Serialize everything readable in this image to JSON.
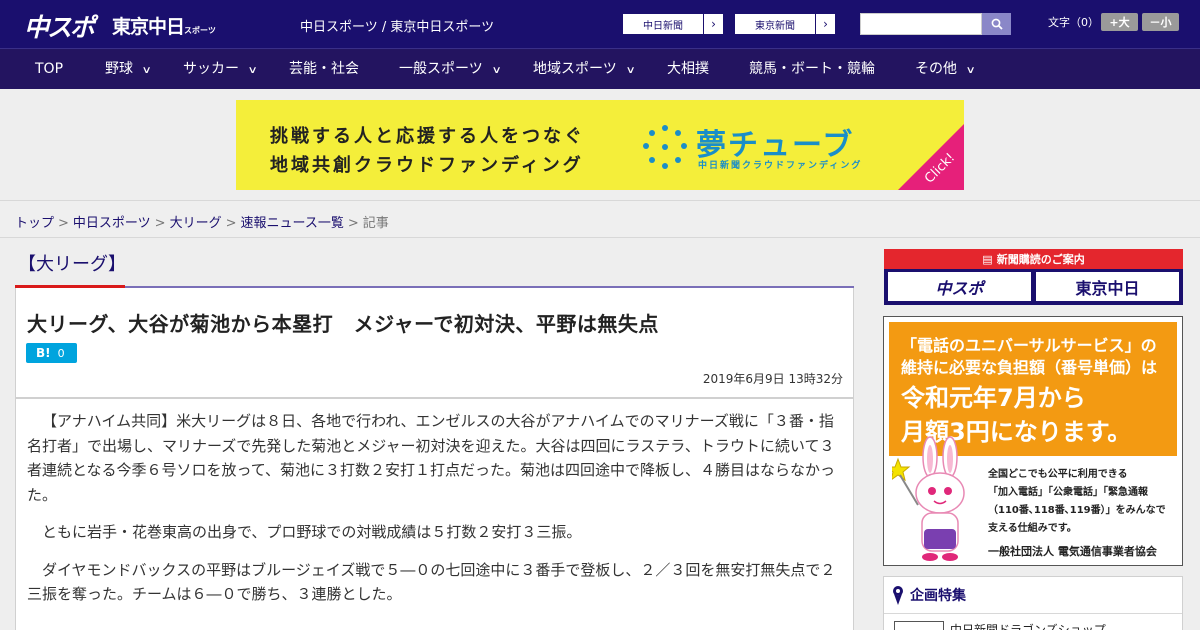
{
  "header": {
    "logo_chunichi": "中スポ",
    "logo_tokyo": "東京中日",
    "logo_tokyo_suffix": "スポーツ",
    "site_links": "中日スポーツ / 東京中日スポーツ",
    "external_links": [
      {
        "label": "中日新聞"
      },
      {
        "label": "東京新聞"
      }
    ],
    "search": {
      "value": "",
      "placeholder": ""
    },
    "font_size_label": "文字（0）",
    "font_larger": "+大",
    "font_smaller": "－小"
  },
  "nav": {
    "items": [
      {
        "label": "TOP",
        "has_dropdown": false
      },
      {
        "label": "野球",
        "has_dropdown": true
      },
      {
        "label": "サッカー",
        "has_dropdown": true
      },
      {
        "label": "芸能・社会",
        "has_dropdown": false
      },
      {
        "label": "一般スポーツ",
        "has_dropdown": true
      },
      {
        "label": "地域スポーツ",
        "has_dropdown": true
      },
      {
        "label": "大相撲",
        "has_dropdown": false
      },
      {
        "label": "競馬・ボート・競輪",
        "has_dropdown": false
      },
      {
        "label": "その他",
        "has_dropdown": true
      }
    ]
  },
  "banner": {
    "line1": "挑戦する人と応援する人をつなぐ",
    "line2": "地域共創クラウドファンディング",
    "brand": "夢チューブ",
    "brand_sub": "中日新聞クラウドファンディング",
    "click_label": "Click!",
    "colors": {
      "background": "#f4ee3a",
      "brand": "#1a8ec8",
      "click": "#e6207a"
    }
  },
  "breadcrumb": {
    "items": [
      "トップ",
      "中日スポーツ",
      "大リーグ",
      "速報ニュース一覧"
    ],
    "current": "記事"
  },
  "article": {
    "category": "【大リーグ】",
    "title": "大リーグ、大谷が菊池から本塁打　メジャーで初対決、平野は無失点",
    "hatena_label": "B!",
    "hatena_count": "0",
    "date": "2019年6月9日 13時32分",
    "paragraphs": [
      "【アナハイム共同】米大リーグは８日、各地で行われ、エンゼルスの大谷がアナハイムでのマリナーズ戦に「３番・指名打者」で出場し、マリナーズで先発した菊池とメジャー初対決を迎えた。大谷は四回にラステラ、トラウトに続いて３者連続となる今季６号ソロを放って、菊池に３打数２安打１打点だった。菊池は四回途中で降板し、４勝目はならなかった。",
      "ともに岩手・花巻東高の出身で、プロ野球での対戦成績は５打数２安打３三振。",
      "ダイヤモンドバックスの平野はブルージェイズ戦で５―０の七回途中に３番手で登板し、２／３回を無安打無失点で２三振を奪った。チームは６―０で勝ち、３連勝とした。"
    ]
  },
  "sidebar": {
    "subscription_heading": "新聞購読のご案内",
    "subscription_logos": [
      "中スポ",
      "東京中日"
    ],
    "ad": {
      "line1": "「電話のユニバーサルサービス」の",
      "line2": "維持に必要な負担額（番号単価）は",
      "line3": "令和元年7月から",
      "line4": "月額3円になります。",
      "body": [
        "全国どこでも公平に利用できる",
        "「加入電話」「公衆電話」「緊急通報",
        "（110番､118番､119番）」をみんなで",
        "支える仕組みです。"
      ],
      "org": "一般社団法人 電気通信事業者協会"
    },
    "feature_heading": "企画特集",
    "feature_item": "中日新聞ドラゴンズショップ"
  },
  "colors": {
    "header_bg": "#1a0f6e",
    "nav_bg": "#231460",
    "accent_red": "#d91a1a",
    "accent_purple": "#7a6fb8",
    "hatena_blue": "#00a4de",
    "ad_orange": "#f39a12"
  }
}
